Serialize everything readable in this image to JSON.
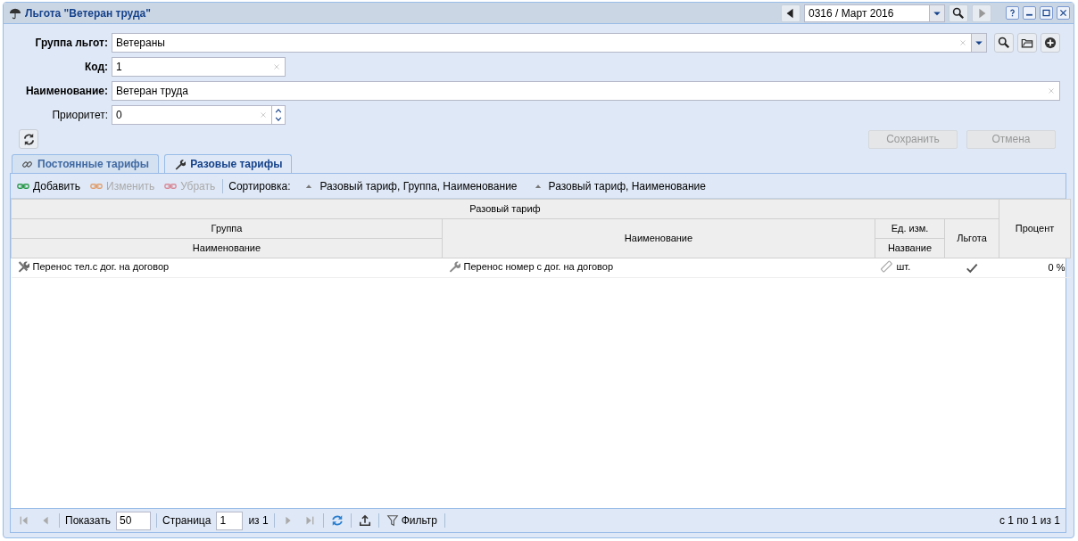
{
  "window": {
    "title": "Льгота \"Ветеран труда\""
  },
  "period": {
    "value": "0316 / Март 2016",
    "next_disabled": true
  },
  "form": {
    "fields": [
      {
        "label": "Группа льгот:",
        "value": "Ветераны",
        "required": true,
        "kind": "combo"
      },
      {
        "label": "Код:",
        "value": "1",
        "required": true,
        "kind": "short"
      },
      {
        "label": "Наименование:",
        "value": "Ветеран труда",
        "required": true,
        "kind": "wide"
      },
      {
        "label": "Приоритет:",
        "value": "0",
        "required": false,
        "kind": "spinner"
      }
    ]
  },
  "actions": [
    {
      "label": "Сохранить",
      "disabled": true
    },
    {
      "label": "Отмена",
      "disabled": true
    }
  ],
  "tabs": [
    {
      "label": "Постоянные тарифы",
      "selected": false,
      "kind": "link"
    },
    {
      "label": "Разовые тарифы",
      "selected": true,
      "kind": "wrench"
    }
  ],
  "toolbar": {
    "buttons": [
      {
        "label": "Добавить",
        "disabled": false,
        "kind": "add"
      },
      {
        "label": "Изменить",
        "disabled": true,
        "kind": "edit"
      },
      {
        "label": "Убрать",
        "disabled": true,
        "kind": "remove"
      }
    ],
    "sort_label": "Сортировка:",
    "sort_options": [
      "Разовый тариф, Группа, Наименование",
      "Разовый тариф, Наименование"
    ]
  },
  "table": {
    "group_header": "Разовый тариф",
    "columns": {
      "group": "Группа",
      "group_name": "Наименование",
      "name": "Наименование",
      "unit": "Ед. изм.",
      "unit_name": "Название",
      "benefit": "Льгота",
      "percent": "Процент"
    },
    "rows": [
      {
        "group_name": "Перенос тел.с дог. на договор",
        "name": "Перенос номер с дог. на договор",
        "unit_name": "шт.",
        "benefit": true,
        "percent": "0 %"
      }
    ]
  },
  "pager": {
    "show_label": "Показать",
    "page_size": "50",
    "page_label": "Страница",
    "page": "1",
    "of_label": "из 1",
    "filter_label": "Фильтр",
    "summary": "с 1 по 1 из 1"
  }
}
